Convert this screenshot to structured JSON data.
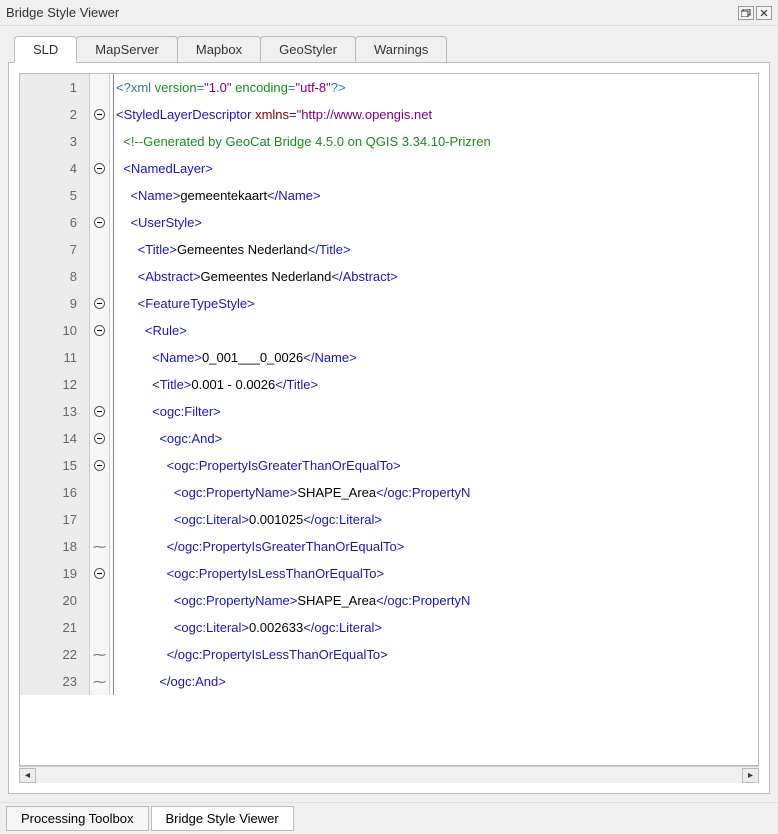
{
  "window": {
    "title": "Bridge Style Viewer"
  },
  "tabs": [
    {
      "label": "SLD",
      "active": true
    },
    {
      "label": "MapServer",
      "active": false
    },
    {
      "label": "Mapbox",
      "active": false
    },
    {
      "label": "GeoStyler",
      "active": false
    },
    {
      "label": "Warnings",
      "active": false
    }
  ],
  "bottom_tabs": [
    {
      "label": "Processing Toolbox",
      "active": false
    },
    {
      "label": "Bridge Style Viewer",
      "active": true
    }
  ],
  "code": {
    "lines": [
      {
        "n": 1,
        "fold": "",
        "indent": 0,
        "tokens": [
          {
            "c": "t-pi",
            "t": "<?xml "
          },
          {
            "c": "t-pi-attr",
            "t": "version"
          },
          {
            "c": "t-pi",
            "t": "="
          },
          {
            "c": "t-val",
            "t": "\"1.0\""
          },
          {
            "c": "t-pi",
            "t": " "
          },
          {
            "c": "t-pi-attr",
            "t": "encoding"
          },
          {
            "c": "t-pi",
            "t": "="
          },
          {
            "c": "t-val",
            "t": "\"utf-8\""
          },
          {
            "c": "t-pi",
            "t": "?>"
          }
        ]
      },
      {
        "n": 2,
        "fold": "open",
        "indent": 0,
        "tokens": [
          {
            "c": "t-tag",
            "t": "<StyledLayerDescriptor "
          },
          {
            "c": "t-attr",
            "t": "xmlns"
          },
          {
            "c": "t-tag",
            "t": "="
          },
          {
            "c": "t-val",
            "t": "\"http://www.opengis.net"
          }
        ]
      },
      {
        "n": 3,
        "fold": "",
        "indent": 1,
        "tokens": [
          {
            "c": "t-comment",
            "t": "<!--Generated by GeoCat Bridge 4.5.0 on QGIS 3.34.10-Prizren"
          }
        ]
      },
      {
        "n": 4,
        "fold": "open",
        "indent": 1,
        "tokens": [
          {
            "c": "t-tag",
            "t": "<NamedLayer>"
          }
        ]
      },
      {
        "n": 5,
        "fold": "",
        "indent": 2,
        "tokens": [
          {
            "c": "t-tag",
            "t": "<Name>"
          },
          {
            "c": "t-text",
            "t": "gemeentekaart"
          },
          {
            "c": "t-tag",
            "t": "</Name>"
          }
        ]
      },
      {
        "n": 6,
        "fold": "open",
        "indent": 2,
        "tokens": [
          {
            "c": "t-tag",
            "t": "<UserStyle>"
          }
        ]
      },
      {
        "n": 7,
        "fold": "",
        "indent": 3,
        "tokens": [
          {
            "c": "t-tag",
            "t": "<Title>"
          },
          {
            "c": "t-text",
            "t": "Gemeentes Nederland"
          },
          {
            "c": "t-tag",
            "t": "</Title>"
          }
        ]
      },
      {
        "n": 8,
        "fold": "",
        "indent": 3,
        "tokens": [
          {
            "c": "t-tag",
            "t": "<Abstract>"
          },
          {
            "c": "t-text",
            "t": "Gemeentes Nederland"
          },
          {
            "c": "t-tag",
            "t": "</Abstract>"
          }
        ]
      },
      {
        "n": 9,
        "fold": "open",
        "indent": 3,
        "tokens": [
          {
            "c": "t-tag",
            "t": "<FeatureTypeStyle>"
          }
        ]
      },
      {
        "n": 10,
        "fold": "open",
        "indent": 4,
        "tokens": [
          {
            "c": "t-tag",
            "t": "<Rule>"
          }
        ]
      },
      {
        "n": 11,
        "fold": "",
        "indent": 5,
        "tokens": [
          {
            "c": "t-tag",
            "t": "<Name>"
          },
          {
            "c": "t-text",
            "t": "0_001___0_0026"
          },
          {
            "c": "t-tag",
            "t": "</Name>"
          }
        ]
      },
      {
        "n": 12,
        "fold": "",
        "indent": 5,
        "tokens": [
          {
            "c": "t-tag",
            "t": "<Title>"
          },
          {
            "c": "t-text",
            "t": "0.001 - 0.0026"
          },
          {
            "c": "t-tag",
            "t": "</Title>"
          }
        ]
      },
      {
        "n": 13,
        "fold": "open",
        "indent": 5,
        "tokens": [
          {
            "c": "t-tag",
            "t": "<ogc:Filter>"
          }
        ]
      },
      {
        "n": 14,
        "fold": "open",
        "indent": 6,
        "tokens": [
          {
            "c": "t-tag",
            "t": "<ogc:And>"
          }
        ]
      },
      {
        "n": 15,
        "fold": "open",
        "indent": 7,
        "tokens": [
          {
            "c": "t-tag",
            "t": "<ogc:PropertyIsGreaterThanOrEqualTo>"
          }
        ]
      },
      {
        "n": 16,
        "fold": "",
        "indent": 8,
        "tokens": [
          {
            "c": "t-tag",
            "t": "<ogc:PropertyName>"
          },
          {
            "c": "t-text",
            "t": "SHAPE_Area"
          },
          {
            "c": "t-tag",
            "t": "</ogc:PropertyN"
          }
        ]
      },
      {
        "n": 17,
        "fold": "",
        "indent": 8,
        "tokens": [
          {
            "c": "t-tag",
            "t": "<ogc:Literal>"
          },
          {
            "c": "t-text",
            "t": "0.001025"
          },
          {
            "c": "t-tag",
            "t": "</ogc:Literal>"
          }
        ]
      },
      {
        "n": 18,
        "fold": "stub",
        "indent": 7,
        "tokens": [
          {
            "c": "t-tag",
            "t": "</ogc:PropertyIsGreaterThanOrEqualTo>"
          }
        ]
      },
      {
        "n": 19,
        "fold": "open",
        "indent": 7,
        "tokens": [
          {
            "c": "t-tag",
            "t": "<ogc:PropertyIsLessThanOrEqualTo>"
          }
        ]
      },
      {
        "n": 20,
        "fold": "",
        "indent": 8,
        "tokens": [
          {
            "c": "t-tag",
            "t": "<ogc:PropertyName>"
          },
          {
            "c": "t-text",
            "t": "SHAPE_Area"
          },
          {
            "c": "t-tag",
            "t": "</ogc:PropertyN"
          }
        ]
      },
      {
        "n": 21,
        "fold": "",
        "indent": 8,
        "tokens": [
          {
            "c": "t-tag",
            "t": "<ogc:Literal>"
          },
          {
            "c": "t-text",
            "t": "0.002633"
          },
          {
            "c": "t-tag",
            "t": "</ogc:Literal>"
          }
        ]
      },
      {
        "n": 22,
        "fold": "stub",
        "indent": 7,
        "tokens": [
          {
            "c": "t-tag",
            "t": "</ogc:PropertyIsLessThanOrEqualTo>"
          }
        ]
      },
      {
        "n": 23,
        "fold": "stub",
        "indent": 6,
        "tokens": [
          {
            "c": "t-tag",
            "t": "</ogc:And>"
          }
        ]
      }
    ]
  }
}
